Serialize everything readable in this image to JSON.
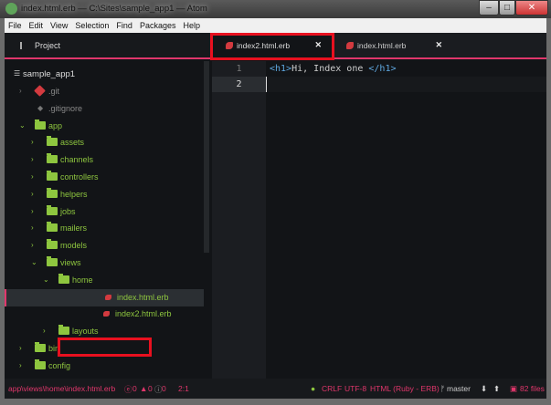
{
  "window": {
    "title": "index.html.erb — C:\\Sites\\sample_app1 — Atom"
  },
  "menu": [
    "File",
    "Edit",
    "View",
    "Selection",
    "Find",
    "Packages",
    "Help"
  ],
  "project_tab": "Project",
  "tabs": [
    {
      "label": "index2.html.erb",
      "active": true
    },
    {
      "label": "index.html.erb",
      "active": false
    }
  ],
  "tree": {
    "root": "sample_app1",
    "items": [
      {
        "label": ".git",
        "depth": 1,
        "type": "git"
      },
      {
        "label": ".gitignore",
        "depth": 1,
        "type": "file"
      },
      {
        "label": "app",
        "depth": 1,
        "type": "folder",
        "open": true
      },
      {
        "label": "assets",
        "depth": 2,
        "type": "folder"
      },
      {
        "label": "channels",
        "depth": 2,
        "type": "folder"
      },
      {
        "label": "controllers",
        "depth": 2,
        "type": "folder"
      },
      {
        "label": "helpers",
        "depth": 2,
        "type": "folder"
      },
      {
        "label": "jobs",
        "depth": 2,
        "type": "folder"
      },
      {
        "label": "mailers",
        "depth": 2,
        "type": "folder"
      },
      {
        "label": "models",
        "depth": 2,
        "type": "folder"
      },
      {
        "label": "views",
        "depth": 2,
        "type": "folder",
        "open": true
      },
      {
        "label": "home",
        "depth": 3,
        "type": "folder",
        "open": true
      },
      {
        "label": "index.html.erb",
        "depth": 4,
        "type": "erb",
        "selected": true
      },
      {
        "label": "index2.html.erb",
        "depth": 4,
        "type": "erb"
      },
      {
        "label": "layouts",
        "depth": 3,
        "type": "folder"
      },
      {
        "label": "bin",
        "depth": 1,
        "type": "folder"
      },
      {
        "label": "config",
        "depth": 1,
        "type": "folder"
      }
    ]
  },
  "editor": {
    "lines": [
      {
        "num": "1",
        "open": "<h1>",
        "text": "Hi, Index one ",
        "close": "</h1>"
      },
      {
        "num": "2"
      }
    ]
  },
  "status": {
    "path": "app\\views\\home\\index.html.erb",
    "errors": "0",
    "warnings": "0",
    "infos": "0",
    "cursor": "2:1",
    "line_ending": "CRLF",
    "encoding": "UTF-8",
    "grammar": "HTML (Ruby - ERB)",
    "branch": "master",
    "files": "82 files"
  }
}
